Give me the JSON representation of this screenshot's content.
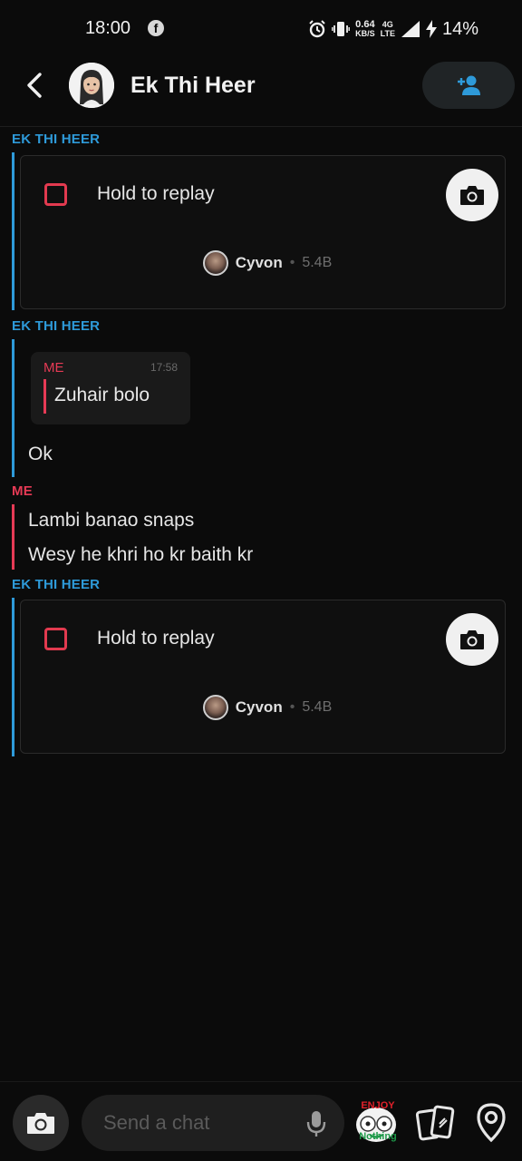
{
  "status_bar": {
    "time": "18:00",
    "net_speed": "0.64",
    "net_unit": "KB/S",
    "net_type_top": "4G",
    "net_type_bottom": "LTE",
    "battery": "14%",
    "icons": [
      "facebook-icon",
      "alarm-icon",
      "vibrate-icon",
      "signal-icon",
      "charging-icon"
    ]
  },
  "header": {
    "title": "Ek Thi Heer",
    "back_icon": "chevron-left-icon",
    "add_friend_icon": "add-friend-icon"
  },
  "messages": [
    {
      "sender": "EK THI HEER",
      "type": "snap",
      "label": "Hold to replay",
      "lens_name": "Cyvon",
      "lens_count": "5.4B",
      "separator": "•"
    },
    {
      "sender": "EK THI HEER",
      "type": "reply",
      "quote": {
        "sender": "ME",
        "time": "17:58",
        "text": "Zuhair bolo"
      },
      "text": "Ok"
    },
    {
      "sender": "ME",
      "type": "text",
      "lines": [
        "Lambi banao snaps",
        "Wesy he khri ho kr baith kr"
      ]
    },
    {
      "sender": "EK THI HEER",
      "type": "snap",
      "label": "Hold to replay",
      "lens_name": "Cyvon",
      "lens_count": "5.4B",
      "separator": "•"
    }
  ],
  "composer": {
    "placeholder": "Send a chat",
    "sticker_text_top": "ENJOY",
    "sticker_text_bottom": "Nothing",
    "icons": [
      "camera-icon",
      "microphone-icon",
      "sticker-icon",
      "cards-icon",
      "location-pin-icon"
    ]
  },
  "colors": {
    "them": "#2e9ad9",
    "me": "#e63a55",
    "background": "#0b0b0b"
  }
}
